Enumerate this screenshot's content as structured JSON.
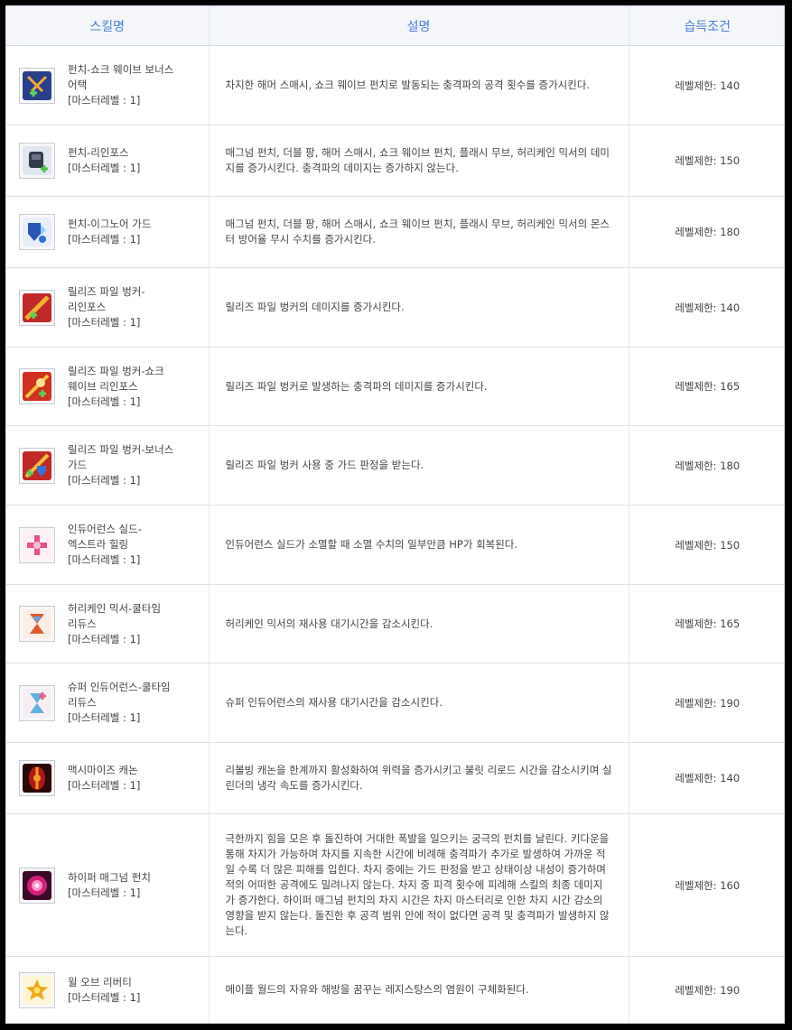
{
  "header": {
    "col_name": "스킬명",
    "col_desc": "설명",
    "col_req": "습득조건"
  },
  "rows": [
    {
      "name_lines": [
        "펀치-쇼크 웨이브 보너스",
        "어택"
      ],
      "master": "[마스터레벨 : 1]",
      "desc": "차지한 해머 스매시, 쇼크 웨이브 펀치로 발동되는 충격파의 공격 횟수를 증가시킨다.",
      "req": "레벨제한: 140",
      "icon": "crossed-swords-plus-icon",
      "colors": [
        "#3a5fd0",
        "#f2a93a"
      ]
    },
    {
      "name_lines": [
        "펀치-리인포스"
      ],
      "master": "[마스터레벨 : 1]",
      "desc": "매그넘 펀치, 더블 팡, 해머 스매시, 쇼크 웨이브 펀치, 플래시 무브, 허리케인 믹서의 데미지를 증가시킨다. 충격파의 데미지는 증가하지 않는다.",
      "req": "레벨제한: 150",
      "icon": "dark-fist-plus-icon",
      "colors": [
        "#333a48",
        "#4bbf4a"
      ]
    },
    {
      "name_lines": [
        "펀치-이그노어 가드"
      ],
      "master": "[마스터레벨 : 1]",
      "desc": "매그넘 펀치, 더블 팡, 해머 스매시, 쇼크 웨이브 펀치, 플래시 무브, 허리케인 믹서의 몬스터 방어율 무시 수치를 증가시킨다.",
      "req": "레벨제한: 180",
      "icon": "blue-shield-arrow-icon",
      "colors": [
        "#2a55b8",
        "#8fd0ff"
      ]
    },
    {
      "name_lines": [
        "릴리즈 파일 벙커-",
        "리인포스"
      ],
      "master": "[마스터레벨 : 1]",
      "desc": "릴리즈 파일 벙커의 데미지를 증가시킨다.",
      "req": "레벨제한: 140",
      "icon": "fire-pile-bunker-plus-icon",
      "colors": [
        "#c0282a",
        "#f0b030"
      ]
    },
    {
      "name_lines": [
        "릴리즈 파일 벙커-쇼크",
        "웨이브 리인포스"
      ],
      "master": "[마스터레벨 : 1]",
      "desc": "릴리즈 파일 벙커로 발생하는 충격파의 데미지를 증가시킨다.",
      "req": "레벨제한: 165",
      "icon": "fire-wave-plus-icon",
      "colors": [
        "#d03020",
        "#f5c040"
      ]
    },
    {
      "name_lines": [
        "릴리즈 파일 벙커-보너스",
        "가드"
      ],
      "master": "[마스터레벨 : 1]",
      "desc": "릴리즈 파일 벙커 사용 중 가드 판정을 받는다.",
      "req": "레벨제한: 180",
      "icon": "fire-guard-shield-icon",
      "colors": [
        "#c02a26",
        "#3a70d8"
      ]
    },
    {
      "name_lines": [
        "인듀어런스 실드-",
        "엑스트라 힐링"
      ],
      "master": "[마스터레벨 : 1]",
      "desc": "인듀어런스 실드가 소멸할 때 소멸 수치의 일부만큼 HP가 회복된다.",
      "req": "레벨제한: 150",
      "icon": "pink-heal-cross-icon",
      "colors": [
        "#e8508a",
        "#f0c0d8"
      ]
    },
    {
      "name_lines": [
        "허리케인 믹서-쿨타임",
        "리듀스"
      ],
      "master": "[마스터레벨 : 1]",
      "desc": "허리케인 믹서의 재사용 대기시간을 감소시킨다.",
      "req": "레벨제한: 165",
      "icon": "hourglass-flame-icon",
      "colors": [
        "#e05830",
        "#6aa0e0"
      ]
    },
    {
      "name_lines": [
        "슈퍼 인듀어런스-쿨타임",
        "리듀스"
      ],
      "master": "[마스터레벨 : 1]",
      "desc": "슈퍼 인듀어런스의 재사용 대기시간을 감소시킨다.",
      "req": "레벨제한: 190",
      "icon": "hourglass-heal-icon",
      "colors": [
        "#e06080",
        "#60b0e0"
      ]
    },
    {
      "name_lines": [
        "맥시마이즈 캐논"
      ],
      "master": "[마스터레벨 : 1]",
      "desc": "리볼빙 캐논을 한계까지 활성화하여 위력을 증가시키고 불릿 리로드 시간을 감소시키며 실린더의 냉각 속도를 증가시킨다.",
      "req": "레벨제한: 140",
      "icon": "red-cannon-cylinder-icon",
      "colors": [
        "#b01818",
        "#f0a020"
      ]
    },
    {
      "name_lines": [
        "하이퍼 매그넘 펀치"
      ],
      "master": "[마스터레벨 : 1]",
      "desc": "극한까지 힘을 모은 후 돌진하여 거대한 폭발을 일으키는 궁극의 펀치를 날린다. 키다운을 통해 차지가 가능하며 차지를 지속한 시간에 비례해 충격파가 추가로 발생하여 가까운 적일 수록 더 많은 피해를 입힌다. 차지 중에는 가드 판정을 받고 상태이상 내성이 증가하며 적의 어떠한 공격에도 밀려나지 않는다. 차지 중 피격 횟수에 피례해 스킬의 최종 데미지가 증가한다. 하이퍼 매그넘 펀치의 차지 시간은 차지 마스터리로 인한 차지 시간 감소의 영향을 받지 않는다. 돌진한 후 공격 범위 안에 적이 없다면 공격 및 충격파가 발생하지 않는다.",
      "req": "레벨제한: 160",
      "icon": "magenta-energy-burst-icon",
      "colors": [
        "#d0207a",
        "#ff8ac8"
      ]
    },
    {
      "name_lines": [
        "윌 오브 리버티"
      ],
      "master": "[마스터레벨 : 1]",
      "desc": "메이플 월드의 자유와 해방을 꿈꾸는 레지스탕스의 염원이 구체화된다.",
      "req": "레벨제한: 190",
      "icon": "golden-star-emblem-icon",
      "colors": [
        "#f0a818",
        "#ffe070"
      ]
    }
  ]
}
